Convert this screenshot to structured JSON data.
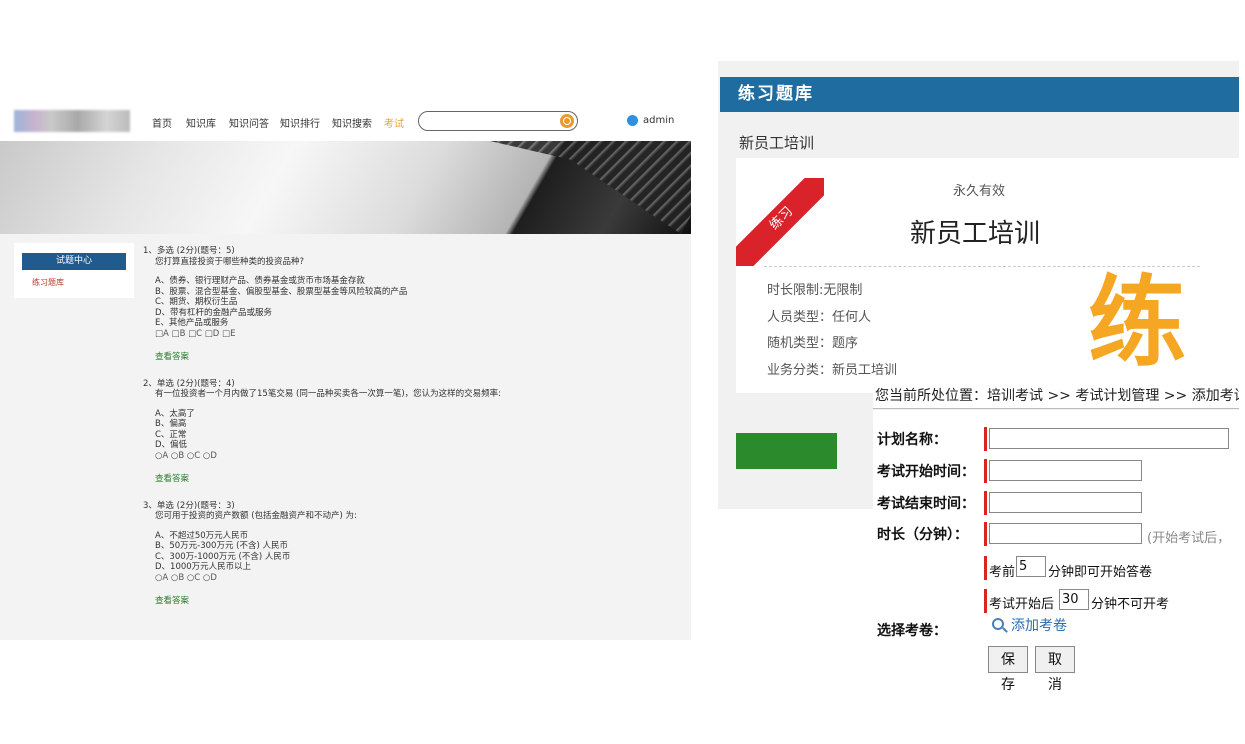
{
  "left": {
    "nav": [
      "首页",
      "知识库",
      "知识问答",
      "知识排行",
      "知识搜索",
      "考试"
    ],
    "user": "admin",
    "sidebar": {
      "title": "试题中心",
      "item": "练习题库"
    },
    "questions": [
      {
        "head": "1、多选 (2分)(题号：5)",
        "text": "您打算直接投资于哪些种类的投资品种?",
        "options": [
          "A、债券、银行理财产品、债券基金或货币市场基金存款",
          "B、股票、混合型基金、偏股型基金、股票型基金等风险较高的产品",
          "C、期货、期权衍生品",
          "D、带有杠杆的金融产品或服务",
          "E、其他产品或服务"
        ],
        "choices": "□A □B □C □D □E",
        "answer": "查看答案"
      },
      {
        "head": "2、单选 (2分)(题号：4)",
        "text": "有一位投资者一个月内做了15笔交易 (同一品种买卖各一次算一笔)，您认为这样的交易频率:",
        "options": [
          "A、太高了",
          "B、偏高",
          "C、正常",
          "D、偏低"
        ],
        "choices": "○A ○B ○C ○D",
        "answer": "查看答案"
      },
      {
        "head": "3、单选 (2分)(题号：3)",
        "text": "您可用于投资的资产数额 (包括金融资产和不动产) 为:",
        "options": [
          "A、不超过50万元人民币",
          "B、50万元-300万元 (不含) 人民币",
          "C、300万-1000万元 (不含) 人民币",
          "D、1000万元人民币以上"
        ],
        "choices": "○A ○B ○C ○D",
        "answer": "查看答案"
      }
    ]
  },
  "right": {
    "header": "练习题库",
    "section_title": "新员工培训",
    "card": {
      "ribbon": "练习",
      "validity": "永久有效",
      "name": "新员工培训",
      "info": [
        "时长限制:无限制",
        "人员类型：任何人",
        "随机类型：题序",
        "业务分类：新员工培训"
      ],
      "big_char": "练"
    }
  },
  "form": {
    "breadcrumb": "您当前所处位置：培训考试 >> 考试计划管理 >> 添加考试",
    "labels": {
      "plan_name": "计划名称：",
      "start_time": "考试开始时间：",
      "end_time": "考试结束时间：",
      "duration": "时长（分钟）：",
      "select_paper": "选择考卷："
    },
    "duration_hint": "(开始考试后，",
    "before_prefix": "考前",
    "before_value": "5",
    "before_suffix": "分钟即可开始答卷",
    "after_prefix": "考试开始后",
    "after_value": "30",
    "after_suffix": "分钟不可开考",
    "add_paper": "添加考卷",
    "save": "保存",
    "cancel": "取消"
  }
}
